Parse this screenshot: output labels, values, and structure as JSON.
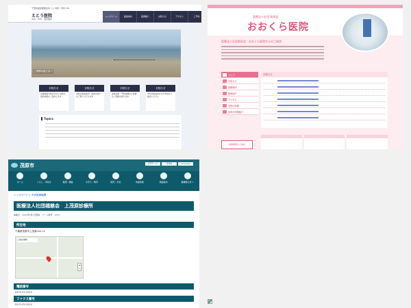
{
  "screens": {
    "eto": {
      "top_line": "千葉県長生郡長生村 ○○ 内科・外科 TEL",
      "title": "えとう医院",
      "subtitle": "内科・外科・消化器科",
      "nav": [
        "トップページ",
        "医療案内",
        "医師紹介",
        "お知らせ",
        "アクセス",
        "ご予約"
      ],
      "hero_caption": "ご来院の皆さまへ",
      "cards": [
        {
          "heading": "お知らせ",
          "text": "診療時間や休診日など当院の最新情報をご案内します"
        },
        {
          "heading": "お知らせ",
          "text": "当院の医療案内・医師の紹介をご覧いただけます"
        },
        {
          "heading": "お知らせ",
          "text": "健康診断・予防接種など各種のご相談を承ります"
        },
        {
          "heading": "お知らせ",
          "text": "予約専用電話からの予約をご確認ください"
        }
      ],
      "topics_title": "Topics"
    },
    "okura": {
      "org": "医療法人社団 和泉会",
      "name": "おおくら医院",
      "welcome": "医療法人社団和泉会　おおくら医院からのご挨拶",
      "menu": [
        "トップ",
        "お知らせ",
        "医療案内",
        "医師紹介",
        "アクセス",
        "当院の特徴",
        "当院の特徴紹介"
      ],
      "news_heading": "お知らせ",
      "hours_label": "診療時間のご案内"
    },
    "mobara": {
      "city": "茂原市",
      "tools": [
        "文字サイズ",
        "背景色",
        "Language"
      ],
      "menu": [
        "ホーム",
        "くらし・手続き",
        "健康・福祉",
        "子育て・教育",
        "観光・文化",
        "市政情報",
        "施設案内",
        "事業者の方へ"
      ],
      "breadcrumb": "トップページ > 市内医療機関",
      "title": "医療法人社団福慈会　上茂原診療所",
      "meta": "掲載日：2021年9月1日更新　ページ番号：1234",
      "sections": {
        "location": "所在地",
        "phone": "電話番号",
        "fax": "ファクス番号"
      },
      "address": "千葉県茂原市上茂原000-12",
      "map_callout": "上茂原診療所",
      "phone": "0475-25-2510",
      "fax": "0475-25-2510"
    }
  },
  "colors": {
    "eto_navy": "#2b2f48",
    "okura_pink": "#e0577a",
    "mobara_teal": "#0f5a6a"
  }
}
